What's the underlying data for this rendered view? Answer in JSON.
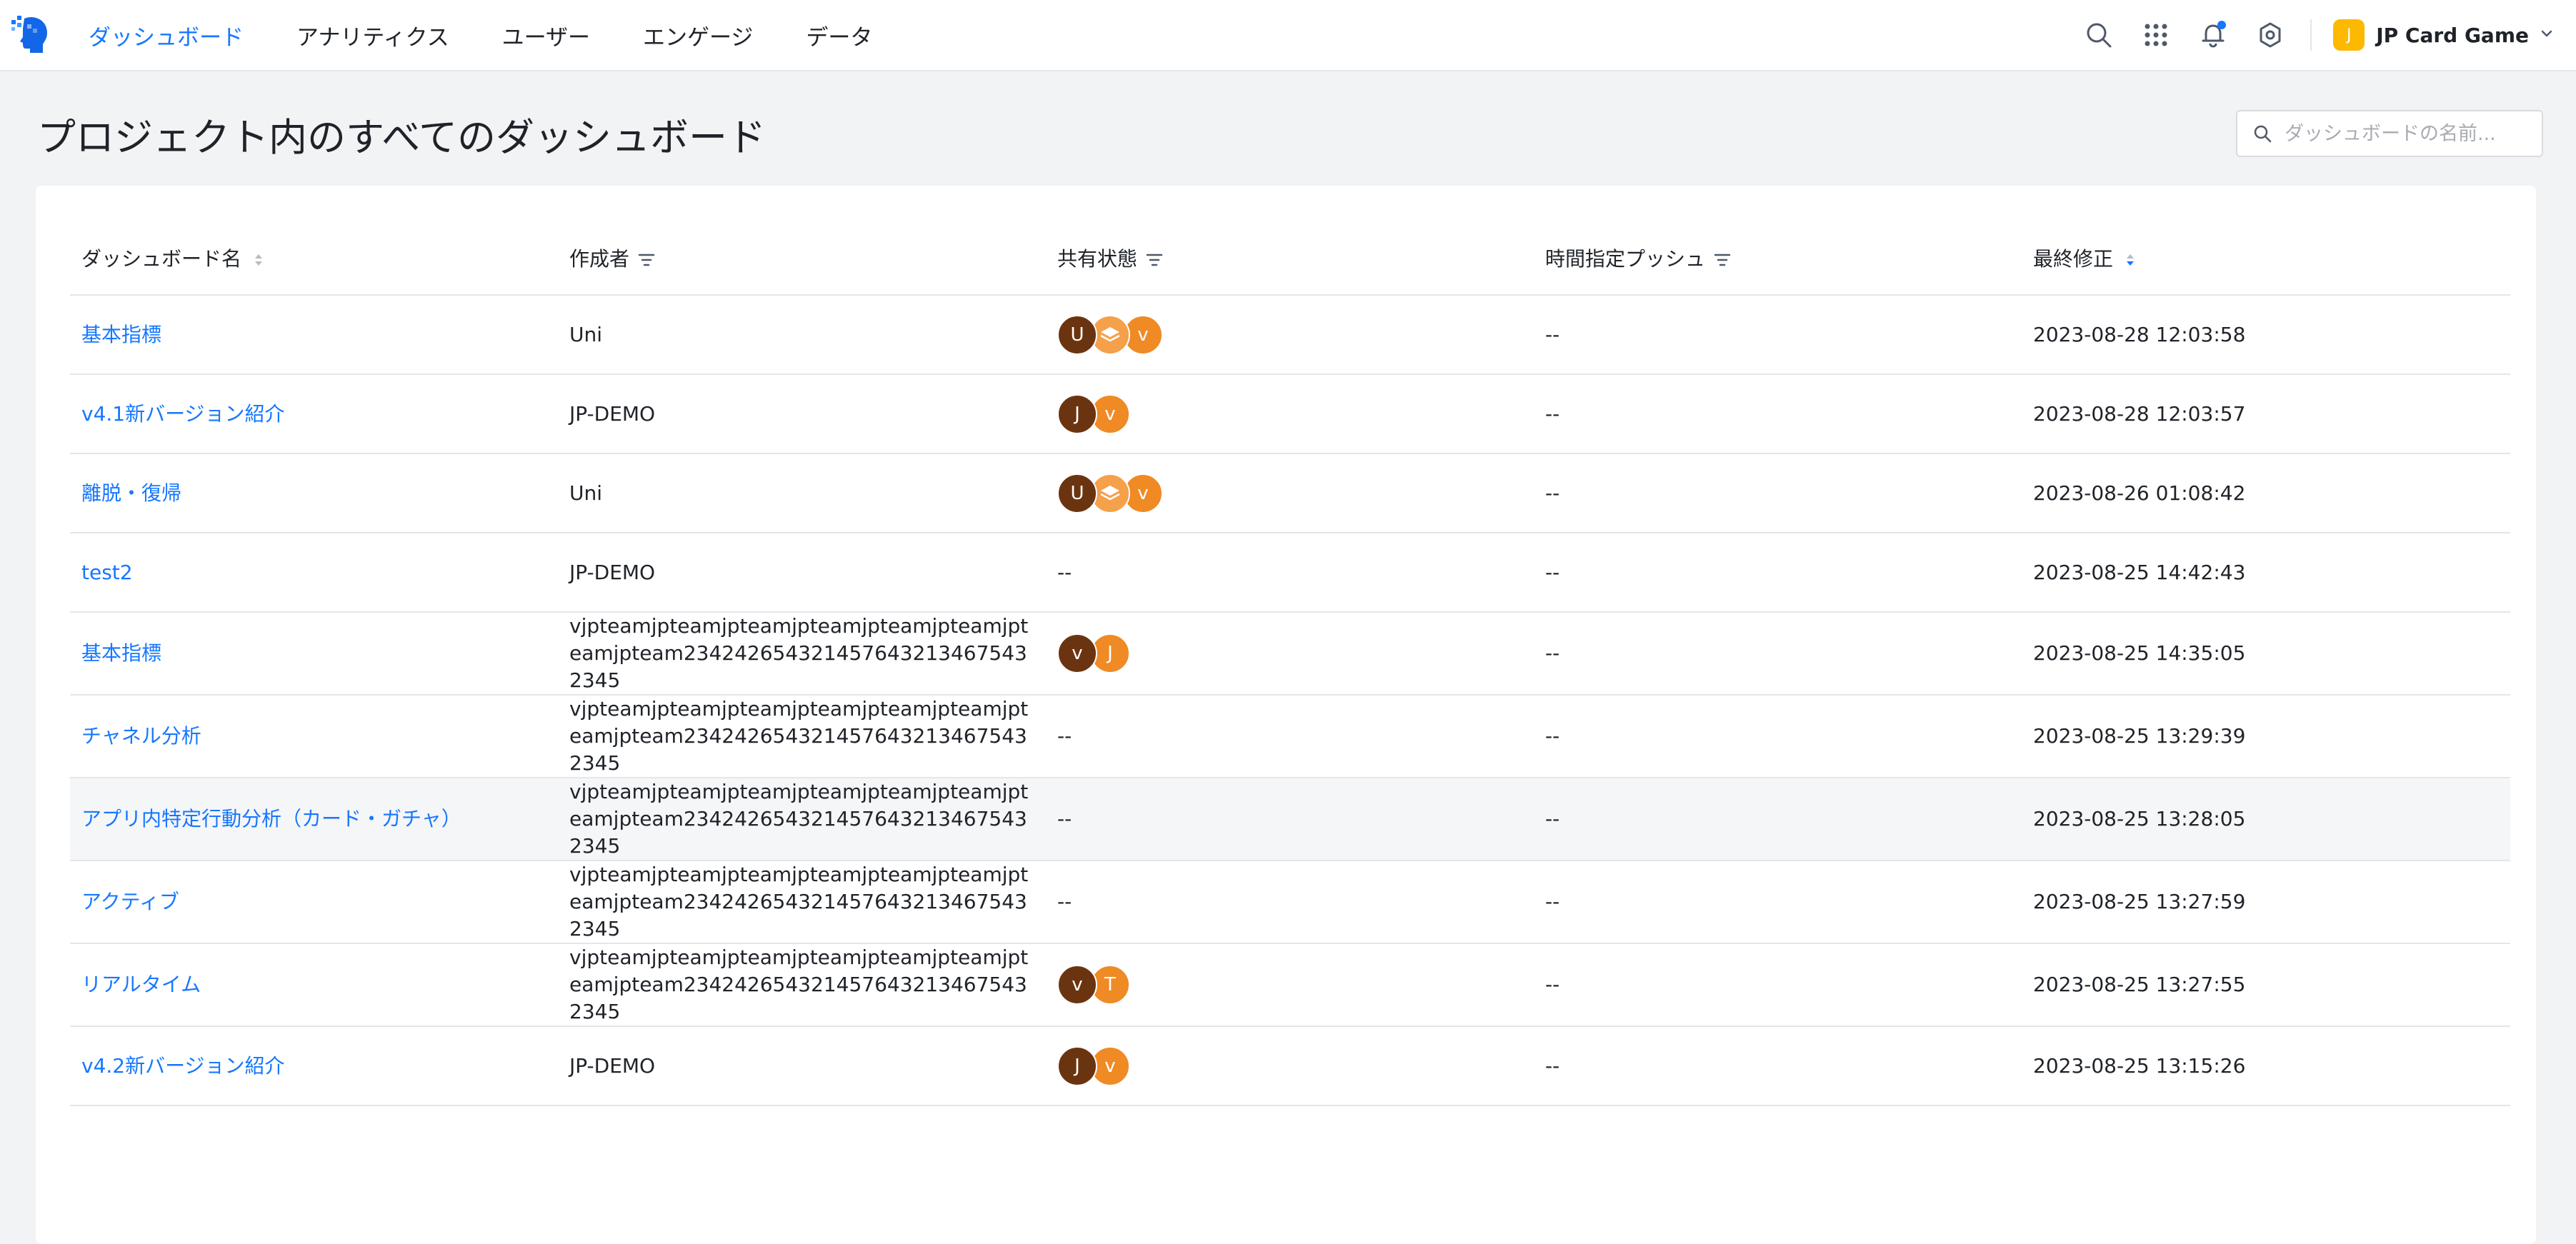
{
  "nav": {
    "items": [
      {
        "label": "ダッシュボード",
        "active": true
      },
      {
        "label": "アナリティクス",
        "active": false
      },
      {
        "label": "ユーザー",
        "active": false
      },
      {
        "label": "エンゲージ",
        "active": false
      },
      {
        "label": "データ",
        "active": false
      }
    ],
    "project_badge": "J",
    "project_name": "JP Card Game"
  },
  "page": {
    "title": "プロジェクト内のすべてのダッシュボード",
    "search_placeholder": "ダッシュボードの名前..."
  },
  "table": {
    "headers": {
      "name": "ダッシュボード名",
      "creator": "作成者",
      "sharing": "共有状態",
      "push": "時間指定プッシュ",
      "modified": "最終修正"
    },
    "rows": [
      {
        "name": "基本指標",
        "creator": "Uni",
        "sharing": [
          "U",
          "layers",
          "v"
        ],
        "sharing_text": "",
        "push": "--",
        "modified": "2023-08-28 12:03:58"
      },
      {
        "name": "v4.1新バージョン紹介",
        "creator": "JP-DEMO",
        "sharing": [
          "J",
          "v"
        ],
        "sharing_text": "",
        "push": "--",
        "modified": "2023-08-28 12:03:57"
      },
      {
        "name": "離脱・復帰",
        "creator": "Uni",
        "sharing": [
          "U",
          "layers",
          "v"
        ],
        "sharing_text": "",
        "push": "--",
        "modified": "2023-08-26 01:08:42"
      },
      {
        "name": "test2",
        "creator": "JP-DEMO",
        "sharing": [],
        "sharing_text": "--",
        "push": "--",
        "modified": "2023-08-25 14:42:43"
      },
      {
        "name": "基本指標",
        "creator": "vjpteamjpteamjpteamjpteamjpteamjpteamjpteamjpteam2342426543214576432134675432345",
        "sharing": [
          "v",
          "J"
        ],
        "sharing_text": "",
        "push": "--",
        "modified": "2023-08-25 14:35:05"
      },
      {
        "name": "チャネル分析",
        "creator": "vjpteamjpteamjpteamjpteamjpteamjpteamjpteamjpteam2342426543214576432134675432345",
        "sharing": [],
        "sharing_text": "--",
        "push": "--",
        "modified": "2023-08-25 13:29:39"
      },
      {
        "name": "アプリ内特定行動分析（カード・ガチャ）",
        "creator": "vjpteamjpteamjpteamjpteamjpteamjpteamjpteamjpteam2342426543214576432134675432345",
        "sharing": [],
        "sharing_text": "--",
        "push": "--",
        "modified": "2023-08-25 13:28:05"
      },
      {
        "name": "アクティブ",
        "creator": "vjpteamjpteamjpteamjpteamjpteamjpteamjpteamjpteam2342426543214576432134675432345",
        "sharing": [],
        "sharing_text": "--",
        "push": "--",
        "modified": "2023-08-25 13:27:59"
      },
      {
        "name": "リアルタイム",
        "creator": "vjpteamjpteamjpteamjpteamjpteamjpteamjpteamjpteam2342426543214576432134675432345",
        "sharing": [
          "v",
          "T"
        ],
        "sharing_text": "",
        "push": "--",
        "modified": "2023-08-25 13:27:55"
      },
      {
        "name": "v4.2新バージョン紹介",
        "creator": "JP-DEMO",
        "sharing": [
          "J",
          "v"
        ],
        "sharing_text": "",
        "push": "--",
        "modified": "2023-08-25 13:15:26"
      }
    ]
  },
  "colors": {
    "accent": "#1677ff",
    "avatar_dark": "#6b3410",
    "avatar_orange": "#f08a24",
    "avatar_light_orange": "#f5a04a",
    "project_badge": "#fcb900"
  }
}
